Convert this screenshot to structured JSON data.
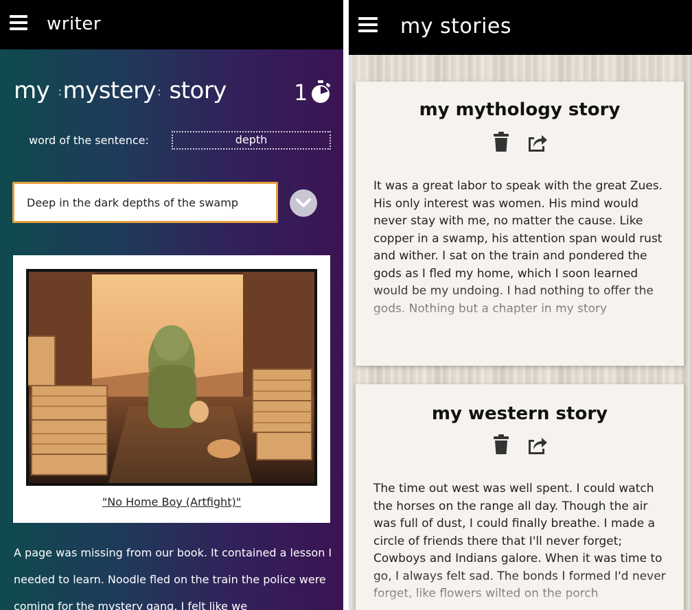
{
  "left": {
    "appbar": {
      "title": "writer",
      "menu_icon": "hamburger-menu-icon"
    },
    "story": {
      "prefix": "my",
      "genre": "mystery",
      "suffix": "story",
      "counter": "1",
      "timer_icon": "stopwatch-icon"
    },
    "word_of_sentence": {
      "label": "word of the sentence:",
      "word": "depth"
    },
    "sentence_input": {
      "value": "Deep in the dark depths of the swamp"
    },
    "dropdown_icon": "chevron-down-icon",
    "artwork": {
      "caption": "\"No Home Boy (Artfight)\""
    },
    "story_text": "A page was missing from our book. It contained a lesson I needed to learn. Noodle fled on the train the police were coming for the mystery gang. I felt like we"
  },
  "right": {
    "appbar": {
      "title": "my stories",
      "menu_icon": "hamburger-menu-icon"
    },
    "stories": [
      {
        "title": "my mythology story",
        "delete_icon": "trash-icon",
        "share_icon": "share-icon",
        "excerpt": "It was a great labor to speak with the great Zues. His only interest was women. His mind would never stay with me, no matter the cause. Like copper in a swamp, his attention span would rust and wither. I sat on the train and pondered the gods as I fled my home, which I soon learned would be my undoing. I had nothing to offer the gods. Nothing but a chapter in my story"
      },
      {
        "title": "my western story",
        "delete_icon": "trash-icon",
        "share_icon": "share-icon",
        "excerpt": "The time out west was well spent. I could watch the horses on the range all day. Though the air was full of dust, I could finally breathe. I made a circle of friends there that I'll never forget; Cowboys and Indians galore. When it was time to go, I always felt sad. The bonds I formed I'd never forget, like flowers wilted on the porch"
      }
    ]
  },
  "colors": {
    "appbar_bg": "#000000",
    "input_border": "#e6a03a",
    "gradient_left": "#0f4a4e",
    "gradient_right": "#3a1452",
    "card_bg": "#f6f3ee"
  }
}
